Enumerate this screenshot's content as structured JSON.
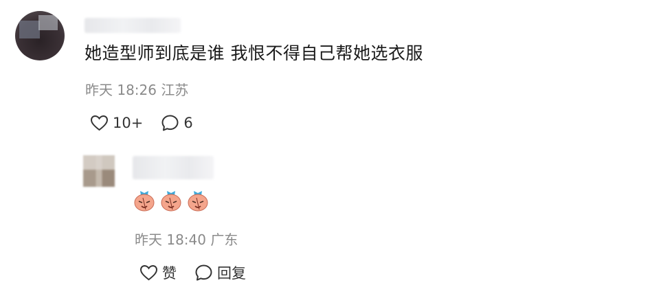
{
  "comment": {
    "text": "她造型师到底是谁 我恨不得自己帮她选衣服",
    "time": "昨天 18:26",
    "location": "江苏",
    "like_count": "10+",
    "reply_count": "6"
  },
  "reply": {
    "time": "昨天 18:40",
    "location": "广东",
    "emoji_count": 3,
    "like_label": "赞",
    "reply_label": "回复"
  },
  "colors": {
    "text": "#1a1a1a",
    "meta": "#8a8a8a",
    "icon": "#333333",
    "emoji_face": "#f4a58c",
    "emoji_bow": "#3fa9d9"
  },
  "icons": [
    "heart-icon",
    "comment-bubble-icon",
    "emoji-icon"
  ]
}
